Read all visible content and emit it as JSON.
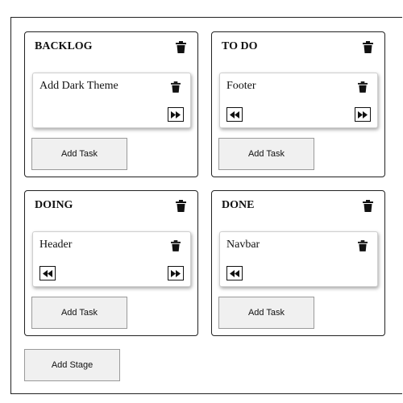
{
  "board": {
    "add_stage_label": "Add Stage",
    "stages": [
      {
        "title": "BACKLOG",
        "add_task_label": "Add Task",
        "card": {
          "title": "Add Dark Theme",
          "has_prev": false,
          "has_next": true
        }
      },
      {
        "title": "TO DO",
        "add_task_label": "Add Task",
        "card": {
          "title": "Footer",
          "has_prev": true,
          "has_next": true
        }
      },
      {
        "title": "DOING",
        "add_task_label": "Add Task",
        "card": {
          "title": "Header",
          "has_prev": true,
          "has_next": true
        }
      },
      {
        "title": "DONE",
        "add_task_label": "Add Task",
        "card": {
          "title": "Navbar",
          "has_prev": true,
          "has_next": false
        }
      }
    ]
  },
  "icons": {
    "stage_delete": "trash-icon",
    "card_delete": "trash-icon",
    "move_prev": "backward-icon",
    "move_next": "forward-icon"
  },
  "colors": {
    "border": "#222222",
    "button_bg": "#f0f0f0",
    "text": "#111111"
  }
}
